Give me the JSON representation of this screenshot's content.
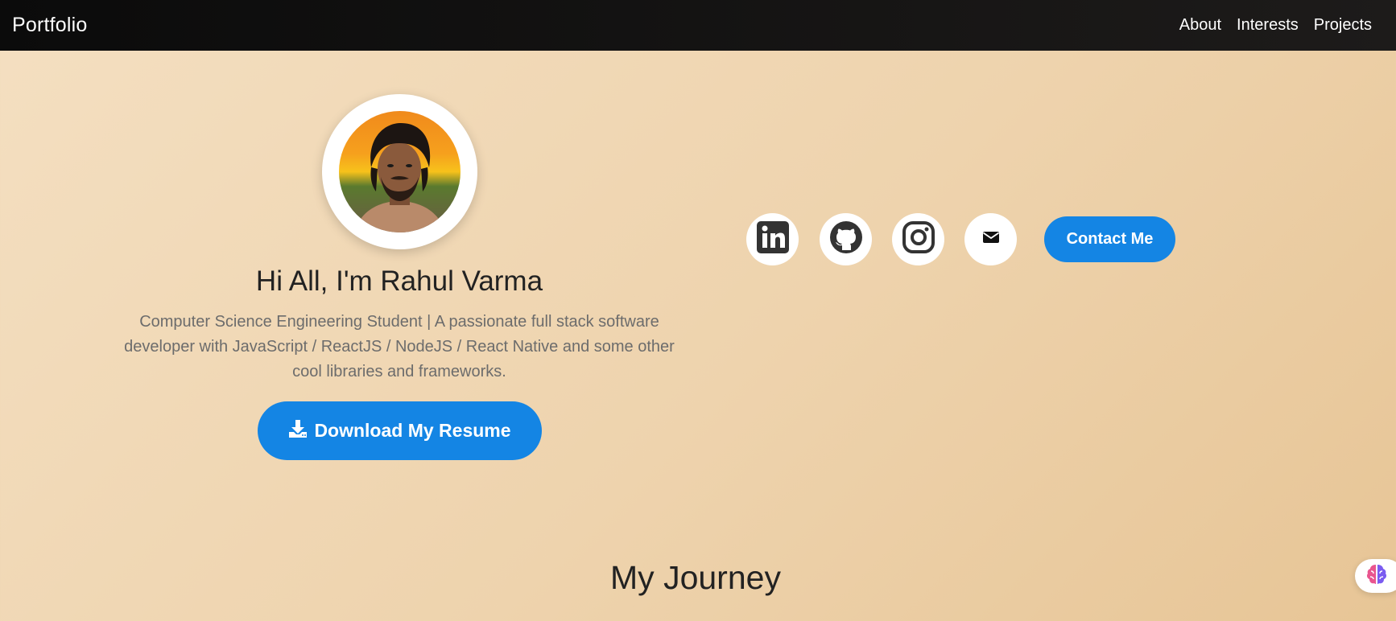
{
  "navbar": {
    "brand": "Portfolio",
    "links": [
      {
        "label": "About"
      },
      {
        "label": "Interests"
      },
      {
        "label": "Projects"
      }
    ]
  },
  "hero": {
    "title": "Hi All, I'm Rahul Varma",
    "description": "Computer Science Engineering Student | A passionate full stack software developer with JavaScript / ReactJS / NodeJS / React Native and some other cool libraries and frameworks.",
    "resume_button": "Download My Resume"
  },
  "social": {
    "icons": [
      "linkedin-icon",
      "github-icon",
      "instagram-icon",
      "email-icon"
    ],
    "contact_button": "Contact Me"
  },
  "journey": {
    "title": "My Journey"
  },
  "colors": {
    "accent": "#1485e4",
    "navbar": "#0b0b0b",
    "background_start": "#f4dfc1",
    "background_end": "#e7c596",
    "icon_dark": "#333333"
  }
}
